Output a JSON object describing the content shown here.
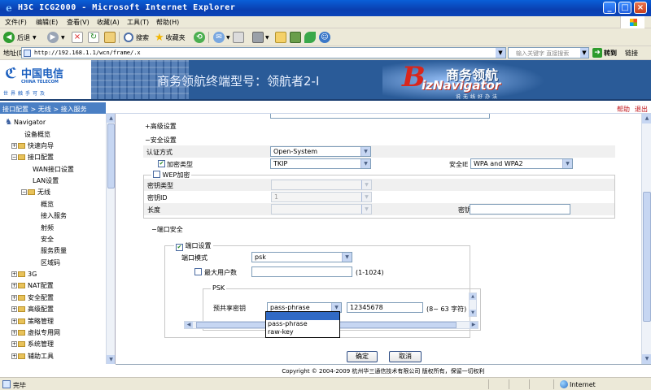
{
  "window": {
    "title": "H3C ICG2000 - Microsoft Internet Explorer"
  },
  "menu": [
    "文件(F)",
    "编辑(E)",
    "查看(V)",
    "收藏(A)",
    "工具(T)",
    "帮助(H)"
  ],
  "toolbar": {
    "back_label": "后退",
    "search_label": "搜索",
    "favorites_label": "收藏夹"
  },
  "address": {
    "label": "地址(D)",
    "url": "http://192.168.1.1/wcn/frame/.x",
    "search_placeholder": "输入关键字 直接搜索",
    "go_label": "转到",
    "links_label": "链接"
  },
  "banner": {
    "logo_cn": "中国电信",
    "logo_en": "CHINA TELECOM",
    "logo_slogan": "世界触手可及",
    "terminal_text": "商务领航终端型号：领航者2-I",
    "brand_cn": "商务领航",
    "brand_b": "B",
    "brand_en": "izNavigator",
    "brand_slogan": "说无线好办法"
  },
  "breadcrumb": {
    "path": "接口配置 > 无线 > 接入服务",
    "help": "帮助",
    "exit": "退出"
  },
  "sidebar": {
    "root": "Navigator",
    "items": [
      {
        "label": "设备概览"
      },
      {
        "label": "快速向导"
      },
      {
        "label": "接口配置"
      },
      {
        "label": "WAN接口设置"
      },
      {
        "label": "LAN设置"
      },
      {
        "label": "无线"
      },
      {
        "label": "概览"
      },
      {
        "label": "接入服务"
      },
      {
        "label": "射频"
      },
      {
        "label": "安全"
      },
      {
        "label": "服务质量"
      },
      {
        "label": "区域码"
      },
      {
        "label": "3G"
      },
      {
        "label": "NAT配置"
      },
      {
        "label": "安全配置"
      },
      {
        "label": "高级配置"
      },
      {
        "label": "策略管理"
      },
      {
        "label": "虚拟专用网"
      },
      {
        "label": "系统管理"
      },
      {
        "label": "辅助工具"
      }
    ]
  },
  "form": {
    "advanced_title": "高级设置",
    "security_title": "安全设置",
    "auth_label": "认证方式",
    "auth_value": "Open-System",
    "encrypt_label": "加密类型",
    "encrypt_value": "TKIP",
    "security_ie_label": "安全IE",
    "security_ie_value": "WPA and WPA2",
    "wep_label": "WEP加密",
    "key_type_label": "密钥类型",
    "key_id_label": "密钥ID",
    "key_id_value": "1",
    "length_label": "长度",
    "key_label": "密钥",
    "port_security_title": "端口安全",
    "port_settings_label": "端口设置",
    "port_mode_label": "端口模式",
    "port_mode_value": "psk",
    "max_users_label": "最大用户数",
    "max_users_hint": "(1-1024)",
    "psk_title": "PSK",
    "psk_key_label": "预共享密钥",
    "psk_type_value": "pass-phrase",
    "psk_key_value": "12345678",
    "psk_hint": "(8~ 63 字符)",
    "psk_options": [
      "pass-phrase",
      "raw-key"
    ],
    "confirm_button": "确定",
    "cancel_button": "取消"
  },
  "footer": {
    "copyright": "Copyright © 2004-2009 杭州华三通信技术有限公司 版权所有，保留一切权利"
  },
  "status": {
    "text": "完毕",
    "zone": "Internet"
  }
}
